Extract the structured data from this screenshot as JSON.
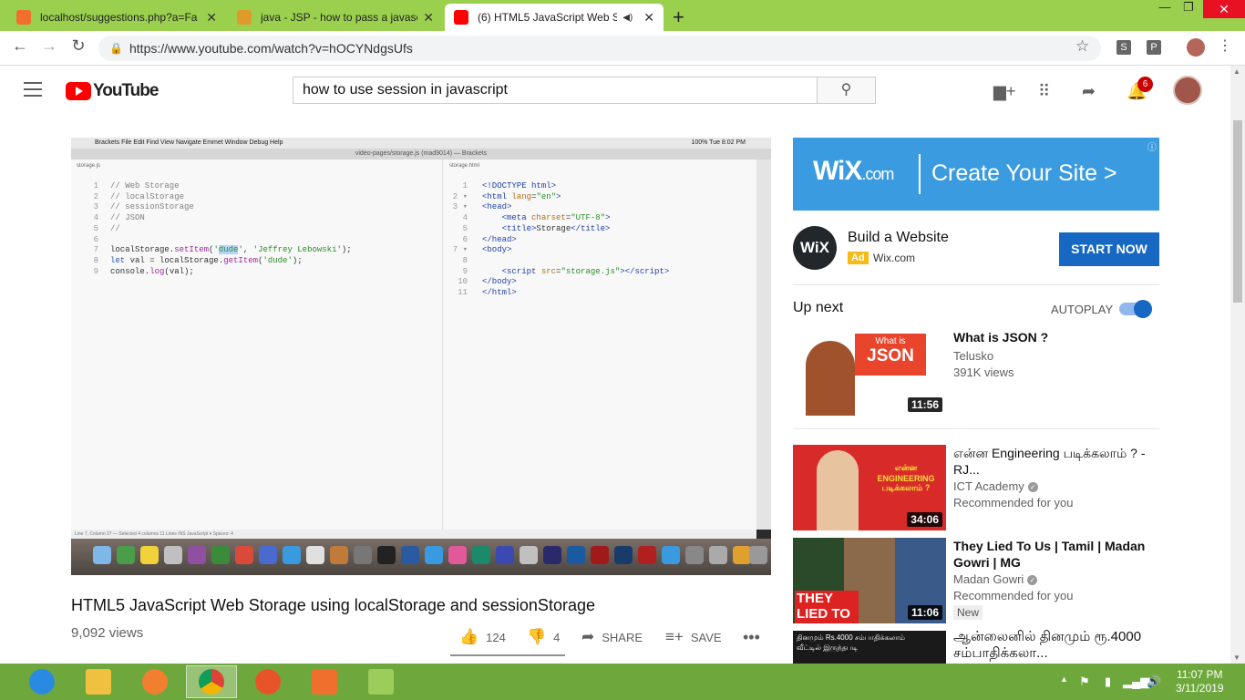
{
  "browser": {
    "tabs": [
      {
        "title": "localhost/suggestions.php?a=Fa",
        "color": "#f06f2d"
      },
      {
        "title": "java - JSP - how to pass a javascr",
        "color": "#e09a2c"
      },
      {
        "title": "(6) HTML5 JavaScript Web St",
        "color": "#ff0000"
      }
    ],
    "url": "https://www.youtube.com/watch?v=hOCYNdgsUfs",
    "ext1": "S",
    "ext2": "P"
  },
  "header": {
    "logo": "YouTube",
    "search_value": "how to use session in javascript",
    "notif_count": "6"
  },
  "video": {
    "title": "HTML5 JavaScript Web Storage using localStorage and sessionStorage",
    "views": "9,092 views",
    "likes": "124",
    "dislikes": "4",
    "share": "SHARE",
    "save": "SAVE",
    "menubar": "Brackets    File    Edit    Find    View    Navigate    Emmet    Window    Debug    Help",
    "menubar_right": "100%   Tue 8:02 PM",
    "window_title": "video-pages/storage.js (mad9014) — Brackets",
    "left_file": "storage.js",
    "right_file": "storage.html",
    "statusbar": "Line 7, Column 27 — Selected 4 columns   11 Lines                                                                                                                                       INS    JavaScript ▾    Spaces: 4"
  },
  "ad": {
    "brand": "WiX",
    "brand_suffix": ".com",
    "cta": "Create Your Site >",
    "title": "Build a Website",
    "badge": "Ad",
    "domain": "Wix.com",
    "button": "START NOW",
    "logo": "WiX"
  },
  "sidebar": {
    "upnext": "Up next",
    "autoplay": "AUTOPLAY",
    "videos": [
      {
        "title": "What is JSON ?",
        "channel": "Telusko",
        "meta": "391K views",
        "duration": "11:56",
        "thumb_text": "What is",
        "thumb_text2": "JSON"
      },
      {
        "title": "என்ன Engineering படிக்கலாம் ? - RJ...",
        "channel": "ICT Academy",
        "meta": "Recommended for you",
        "duration": "34:06",
        "thumb_text": "என்ன ENGINEERING படிக்கலாம் ?"
      },
      {
        "title": "They Lied To Us | Tamil | Madan Gowri | MG",
        "channel": "Madan Gowri",
        "meta": "Recommended for you",
        "duration": "11:06",
        "badge": "New",
        "thumb_text": "THEY LIED TO US"
      },
      {
        "title": "ஆன்லைனில் தினமும் ரூ.4000 சம்பாதிக்கலா...",
        "thumb_text": "தினமும் Rs.4000 சம்பாதிக்கலாம் வீட்டில் இருந்தபடி"
      }
    ]
  },
  "taskbar": {
    "time": "11:07 PM",
    "date": "3/11/2019"
  },
  "colors": {
    "accent": "#1668c2",
    "yt_red": "#ff0000",
    "taskbar": "#6ea83c",
    "tabbar": "#9bd04e"
  }
}
